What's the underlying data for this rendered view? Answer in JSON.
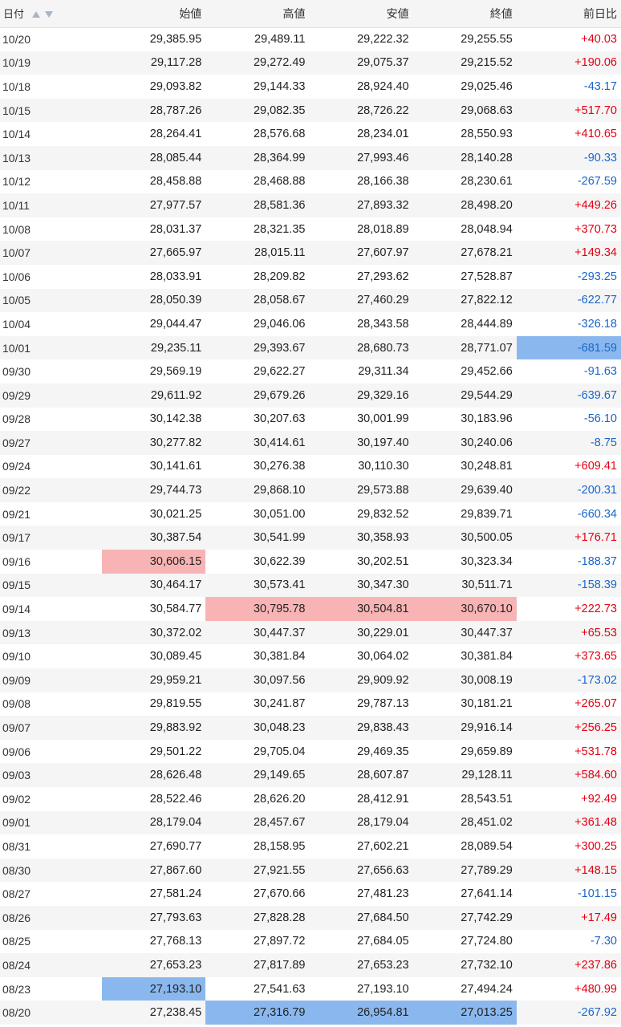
{
  "header": {
    "date": "日付",
    "open": "始値",
    "high": "高値",
    "low": "安値",
    "close": "終値",
    "change": "前日比"
  },
  "rows": [
    {
      "date": "10/20",
      "open": "29,385.95",
      "high": "29,489.11",
      "low": "29,222.32",
      "close": "29,255.55",
      "change": "+40.03"
    },
    {
      "date": "10/19",
      "open": "29,117.28",
      "high": "29,272.49",
      "low": "29,075.37",
      "close": "29,215.52",
      "change": "+190.06"
    },
    {
      "date": "10/18",
      "open": "29,093.82",
      "high": "29,144.33",
      "low": "28,924.40",
      "close": "29,025.46",
      "change": "-43.17"
    },
    {
      "date": "10/15",
      "open": "28,787.26",
      "high": "29,082.35",
      "low": "28,726.22",
      "close": "29,068.63",
      "change": "+517.70"
    },
    {
      "date": "10/14",
      "open": "28,264.41",
      "high": "28,576.68",
      "low": "28,234.01",
      "close": "28,550.93",
      "change": "+410.65"
    },
    {
      "date": "10/13",
      "open": "28,085.44",
      "high": "28,364.99",
      "low": "27,993.46",
      "close": "28,140.28",
      "change": "-90.33"
    },
    {
      "date": "10/12",
      "open": "28,458.88",
      "high": "28,468.88",
      "low": "28,166.38",
      "close": "28,230.61",
      "change": "-267.59"
    },
    {
      "date": "10/11",
      "open": "27,977.57",
      "high": "28,581.36",
      "low": "27,893.32",
      "close": "28,498.20",
      "change": "+449.26"
    },
    {
      "date": "10/08",
      "open": "28,031.37",
      "high": "28,321.35",
      "low": "28,018.89",
      "close": "28,048.94",
      "change": "+370.73"
    },
    {
      "date": "10/07",
      "open": "27,665.97",
      "high": "28,015.11",
      "low": "27,607.97",
      "close": "27,678.21",
      "change": "+149.34"
    },
    {
      "date": "10/06",
      "open": "28,033.91",
      "high": "28,209.82",
      "low": "27,293.62",
      "close": "27,528.87",
      "change": "-293.25"
    },
    {
      "date": "10/05",
      "open": "28,050.39",
      "high": "28,058.67",
      "low": "27,460.29",
      "close": "27,822.12",
      "change": "-622.77"
    },
    {
      "date": "10/04",
      "open": "29,044.47",
      "high": "29,046.06",
      "low": "28,343.58",
      "close": "28,444.89",
      "change": "-326.18"
    },
    {
      "date": "10/01",
      "open": "29,235.11",
      "high": "29,393.67",
      "low": "28,680.73",
      "close": "28,771.07",
      "change": "-681.59"
    },
    {
      "date": "09/30",
      "open": "29,569.19",
      "high": "29,622.27",
      "low": "29,311.34",
      "close": "29,452.66",
      "change": "-91.63"
    },
    {
      "date": "09/29",
      "open": "29,611.92",
      "high": "29,679.26",
      "low": "29,329.16",
      "close": "29,544.29",
      "change": "-639.67"
    },
    {
      "date": "09/28",
      "open": "30,142.38",
      "high": "30,207.63",
      "low": "30,001.99",
      "close": "30,183.96",
      "change": "-56.10"
    },
    {
      "date": "09/27",
      "open": "30,277.82",
      "high": "30,414.61",
      "low": "30,197.40",
      "close": "30,240.06",
      "change": "-8.75"
    },
    {
      "date": "09/24",
      "open": "30,141.61",
      "high": "30,276.38",
      "low": "30,110.30",
      "close": "30,248.81",
      "change": "+609.41"
    },
    {
      "date": "09/22",
      "open": "29,744.73",
      "high": "29,868.10",
      "low": "29,573.88",
      "close": "29,639.40",
      "change": "-200.31"
    },
    {
      "date": "09/21",
      "open": "30,021.25",
      "high": "30,051.00",
      "low": "29,832.52",
      "close": "29,839.71",
      "change": "-660.34"
    },
    {
      "date": "09/17",
      "open": "30,387.54",
      "high": "30,541.99",
      "low": "30,358.93",
      "close": "30,500.05",
      "change": "+176.71"
    },
    {
      "date": "09/16",
      "open": "30,606.15",
      "high": "30,622.39",
      "low": "30,202.51",
      "close": "30,323.34",
      "change": "-188.37"
    },
    {
      "date": "09/15",
      "open": "30,464.17",
      "high": "30,573.41",
      "low": "30,347.30",
      "close": "30,511.71",
      "change": "-158.39"
    },
    {
      "date": "09/14",
      "open": "30,584.77",
      "high": "30,795.78",
      "low": "30,504.81",
      "close": "30,670.10",
      "change": "+222.73"
    },
    {
      "date": "09/13",
      "open": "30,372.02",
      "high": "30,447.37",
      "low": "30,229.01",
      "close": "30,447.37",
      "change": "+65.53"
    },
    {
      "date": "09/10",
      "open": "30,089.45",
      "high": "30,381.84",
      "low": "30,064.02",
      "close": "30,381.84",
      "change": "+373.65"
    },
    {
      "date": "09/09",
      "open": "29,959.21",
      "high": "30,097.56",
      "low": "29,909.92",
      "close": "30,008.19",
      "change": "-173.02"
    },
    {
      "date": "09/08",
      "open": "29,819.55",
      "high": "30,241.87",
      "low": "29,787.13",
      "close": "30,181.21",
      "change": "+265.07"
    },
    {
      "date": "09/07",
      "open": "29,883.92",
      "high": "30,048.23",
      "low": "29,838.43",
      "close": "29,916.14",
      "change": "+256.25"
    },
    {
      "date": "09/06",
      "open": "29,501.22",
      "high": "29,705.04",
      "low": "29,469.35",
      "close": "29,659.89",
      "change": "+531.78"
    },
    {
      "date": "09/03",
      "open": "28,626.48",
      "high": "29,149.65",
      "low": "28,607.87",
      "close": "29,128.11",
      "change": "+584.60"
    },
    {
      "date": "09/02",
      "open": "28,522.46",
      "high": "28,626.20",
      "low": "28,412.91",
      "close": "28,543.51",
      "change": "+92.49"
    },
    {
      "date": "09/01",
      "open": "28,179.04",
      "high": "28,457.67",
      "low": "28,179.04",
      "close": "28,451.02",
      "change": "+361.48"
    },
    {
      "date": "08/31",
      "open": "27,690.77",
      "high": "28,158.95",
      "low": "27,602.21",
      "close": "28,089.54",
      "change": "+300.25"
    },
    {
      "date": "08/30",
      "open": "27,867.60",
      "high": "27,921.55",
      "low": "27,656.63",
      "close": "27,789.29",
      "change": "+148.15"
    },
    {
      "date": "08/27",
      "open": "27,581.24",
      "high": "27,670.66",
      "low": "27,481.23",
      "close": "27,641.14",
      "change": "-101.15"
    },
    {
      "date": "08/26",
      "open": "27,793.63",
      "high": "27,828.28",
      "low": "27,684.50",
      "close": "27,742.29",
      "change": "+17.49"
    },
    {
      "date": "08/25",
      "open": "27,768.13",
      "high": "27,897.72",
      "low": "27,684.05",
      "close": "27,724.80",
      "change": "-7.30"
    },
    {
      "date": "08/24",
      "open": "27,653.23",
      "high": "27,817.89",
      "low": "27,653.23",
      "close": "27,732.10",
      "change": "+237.86"
    },
    {
      "date": "08/23",
      "open": "27,193.10",
      "high": "27,541.63",
      "low": "27,193.10",
      "close": "27,494.24",
      "change": "+480.99"
    },
    {
      "date": "08/20",
      "open": "27,238.45",
      "high": "27,316.79",
      "low": "26,954.81",
      "close": "27,013.25",
      "change": "-267.92"
    }
  ],
  "highlights": {
    "max": [
      {
        "row": 22,
        "col": "open"
      },
      {
        "row": 24,
        "col": "high"
      },
      {
        "row": 24,
        "col": "low"
      },
      {
        "row": 24,
        "col": "close"
      }
    ],
    "min": [
      {
        "row": 13,
        "col": "change"
      },
      {
        "row": 40,
        "col": "open"
      },
      {
        "row": 41,
        "col": "high"
      },
      {
        "row": 41,
        "col": "low"
      },
      {
        "row": 41,
        "col": "close"
      }
    ]
  },
  "colors": {
    "positive": "#e60012",
    "negative": "#1a66cc",
    "max_highlight": "#f8b4b4",
    "min_highlight": "#8ab8ee"
  },
  "sort_icons": [
    "sort-ascending-icon",
    "sort-descending-icon"
  ]
}
